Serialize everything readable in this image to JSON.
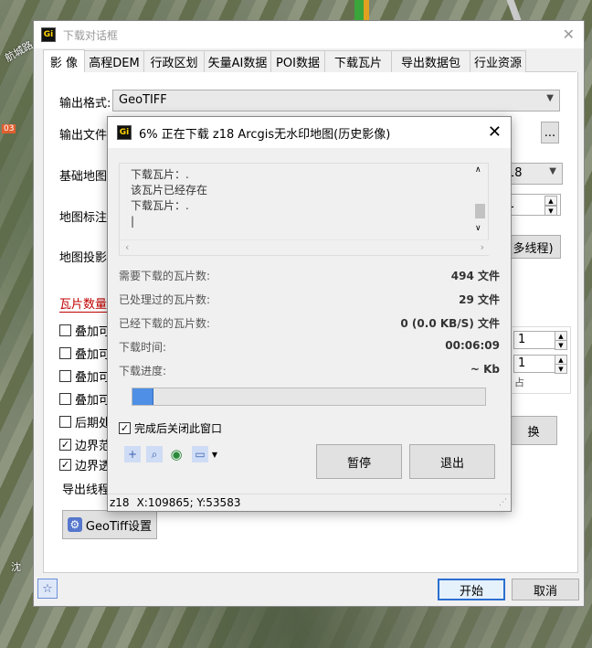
{
  "map": {
    "label1": "航城路",
    "label2": "03",
    "label3": "沈"
  },
  "main": {
    "title": "下载对话框",
    "tabs": [
      "影 像",
      "高程DEM",
      "行政区划",
      "矢量AI数据",
      "POI数据",
      "下载瓦片",
      "导出数据包",
      "行业资源"
    ],
    "output_format_label": "输出格式:",
    "output_format_value": "GeoTIFF",
    "output_file_label": "输出文件",
    "base_map_label": "基础地图",
    "map_annotation_label": "地图标注",
    "map_projection_label": "地图投影",
    "tile_count_label": "瓦片数量",
    "level_value": "18",
    "spin_value1": "1",
    "multithread_btn": "(多线程)",
    "browse_btn": "...",
    "checkboxes": [
      {
        "label": "叠加可",
        "checked": false
      },
      {
        "label": "叠加可",
        "checked": false
      },
      {
        "label": "叠加可",
        "checked": false
      },
      {
        "label": "叠加可",
        "checked": false
      },
      {
        "label": "后期处",
        "checked": false
      },
      {
        "label": "边界范",
        "checked": true
      },
      {
        "label": "边界透",
        "checked": true
      }
    ],
    "right_spin1": "1",
    "right_spin2": "1",
    "right_text": "占",
    "switch_btn": "换",
    "export_line_label": "导出线程",
    "geotiff_btn": "GeoTiff设置",
    "start_btn": "开始",
    "cancel_btn": "取消"
  },
  "progress": {
    "title": "6% 正在下载 z18 Arcgis无水印地图(历史影像)",
    "log": [
      "下载瓦片：.",
      "该瓦片已经存在",
      "下载瓦片：."
    ],
    "stats": [
      {
        "label": "需要下载的瓦片数:",
        "value": "494 文件"
      },
      {
        "label": "已处理过的瓦片数:",
        "value": "29 文件"
      },
      {
        "label": "已经下载的瓦片数:",
        "value": "0 (0.0 KB/S) 文件"
      },
      {
        "label": "下载时间:",
        "value": "00:06:09"
      },
      {
        "label": "下载进度:",
        "value": "~ Kb"
      }
    ],
    "percent": 6,
    "close_after_label": "完成后关闭此窗口",
    "close_after_checked": true,
    "pause_btn": "暂停",
    "exit_btn": "退出",
    "status_zoom": "z18",
    "status_coords": "X:109865; Y:53583"
  }
}
